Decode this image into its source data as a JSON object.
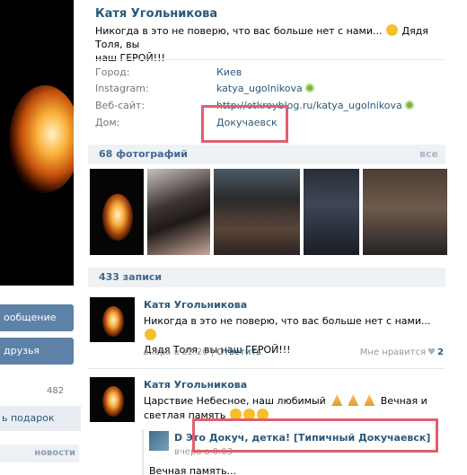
{
  "profile": {
    "name": "Катя Угольникова",
    "status_line1": "Никогда в это не поверю, что вас больше нет с нами...",
    "status_line1b": "Дядя Толя, вы",
    "status_line2": "наш ГЕРОЙ!!!"
  },
  "info": {
    "city_label": "Город:",
    "city_value": "Киев",
    "instagram_label": "Instagram:",
    "instagram_value": "katya_ugolnikova",
    "website_label": "Веб-сайт:",
    "website_value": "http://otkroyblog.ru/katya_ugolnikova",
    "home_label": "Дом:",
    "home_value": "Докучаевск"
  },
  "photos": {
    "header": "68 фотографий",
    "all_label": "все"
  },
  "left": {
    "message_button": "ообщение",
    "friend_button": "друзья",
    "count": "482",
    "gift_button": "ь подарок",
    "news_label": "новости"
  },
  "wall": {
    "header": "433 записи",
    "posts": [
      {
        "author": "Катя Угольникова",
        "text_line1": "Никогда в это не поверю, что вас больше нет с нами...",
        "text_line2": "Дядя Толя, вы наш ГЕРОЙ!!!",
        "date": "вчера в 22:20",
        "separator": "|",
        "reply": "Ответить",
        "like_label": "Мне нравится",
        "like_count": "2"
      },
      {
        "author": "Катя Угольникова",
        "text_line1a": "Царствие Небесное, наш любимый",
        "text_line1b": "Вечная и",
        "text_line2": "светлая память"
      }
    ],
    "repost": {
      "group_prefix": "D",
      "group": "Это Докуч, детка! [Типичный Докучаевск]",
      "date": "вчера в 0:03",
      "text": "Вечная память..."
    }
  },
  "colors": {
    "link": "#2b587a",
    "highlight": "#e0606e",
    "button": "#5e81a8",
    "online": "#7ab23e"
  }
}
